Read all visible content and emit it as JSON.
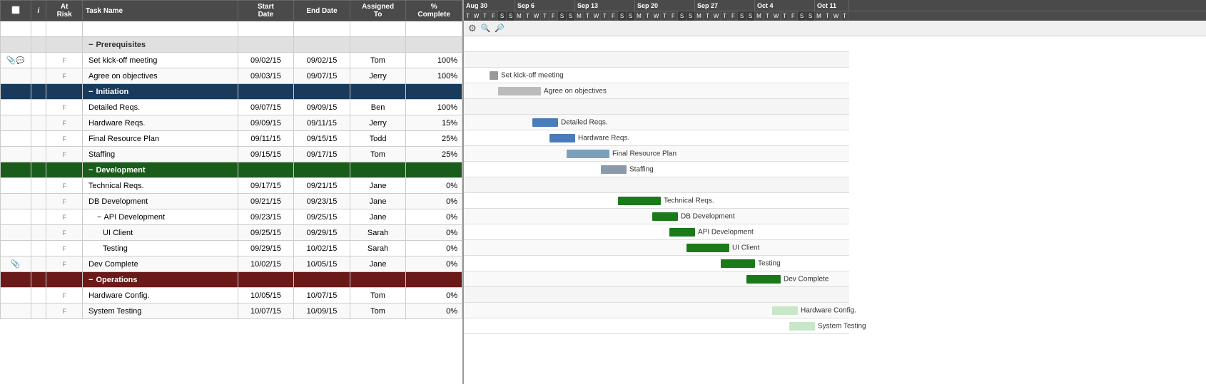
{
  "header": {
    "cols": [
      "",
      "i",
      "At Risk",
      "Task Name",
      "Start Date",
      "End Date",
      "Assigned To",
      "% Complete"
    ]
  },
  "tasks": [
    {
      "id": "blank1",
      "type": "blank",
      "flag": "",
      "alert": "",
      "name": "",
      "start": "",
      "end": "",
      "assigned": "",
      "pct": ""
    },
    {
      "id": "grp-prereq",
      "type": "group-prereq",
      "flag": "",
      "alert": "",
      "name": "Prerequisites",
      "start": "",
      "end": "",
      "assigned": "",
      "pct": "",
      "collapse": "−"
    },
    {
      "id": "task1",
      "type": "task",
      "flag": "F",
      "alert": "attach+comment",
      "name": "Set kick-off meeting",
      "start": "09/02/15",
      "end": "09/02/15",
      "assigned": "Tom",
      "pct": "100%"
    },
    {
      "id": "task2",
      "type": "task",
      "flag": "F",
      "alert": "",
      "name": "Agree on objectives",
      "start": "09/03/15",
      "end": "09/07/15",
      "assigned": "Jerry",
      "pct": "100%"
    },
    {
      "id": "grp-init",
      "type": "group-initiation",
      "flag": "",
      "alert": "",
      "name": "Initiation",
      "start": "",
      "end": "",
      "assigned": "",
      "pct": "",
      "collapse": "−"
    },
    {
      "id": "task3",
      "type": "task",
      "flag": "F",
      "alert": "",
      "name": "Detailed Reqs.",
      "start": "09/07/15",
      "end": "09/09/15",
      "assigned": "Ben",
      "pct": "100%"
    },
    {
      "id": "task4",
      "type": "task",
      "flag": "F",
      "alert": "",
      "name": "Hardware Reqs.",
      "start": "09/09/15",
      "end": "09/11/15",
      "assigned": "Jerry",
      "pct": "15%"
    },
    {
      "id": "task5",
      "type": "task",
      "flag": "F",
      "alert": "",
      "name": "Final Resource Plan",
      "start": "09/11/15",
      "end": "09/15/15",
      "assigned": "Todd",
      "pct": "25%"
    },
    {
      "id": "task6",
      "type": "task",
      "flag": "F",
      "alert": "",
      "name": "Staffing",
      "start": "09/15/15",
      "end": "09/17/15",
      "assigned": "Tom",
      "pct": "25%"
    },
    {
      "id": "grp-dev",
      "type": "group-dev",
      "flag": "",
      "alert": "alert",
      "name": "Development",
      "start": "",
      "end": "",
      "assigned": "",
      "pct": "",
      "collapse": "−"
    },
    {
      "id": "task7",
      "type": "task",
      "flag": "F",
      "alert": "",
      "name": "Technical Reqs.",
      "start": "09/17/15",
      "end": "09/21/15",
      "assigned": "Jane",
      "pct": "0%"
    },
    {
      "id": "task8",
      "type": "task",
      "flag": "F",
      "alert": "",
      "name": "DB Development",
      "start": "09/21/15",
      "end": "09/23/15",
      "assigned": "Jane",
      "pct": "0%"
    },
    {
      "id": "task9",
      "type": "task",
      "flag": "F",
      "alert": "",
      "name": "API Development",
      "start": "09/23/15",
      "end": "09/25/15",
      "assigned": "Jane",
      "pct": "0%",
      "sub": true,
      "collapse": "−"
    },
    {
      "id": "task10",
      "type": "task",
      "flag": "F",
      "alert": "",
      "name": "UI Client",
      "start": "09/25/15",
      "end": "09/29/15",
      "assigned": "Sarah",
      "pct": "0%",
      "indent": 2
    },
    {
      "id": "task11",
      "type": "task",
      "flag": "F",
      "alert": "",
      "name": "Testing",
      "start": "09/29/15",
      "end": "10/02/15",
      "assigned": "Sarah",
      "pct": "0%",
      "indent": 2
    },
    {
      "id": "task12",
      "type": "task",
      "flag": "F",
      "alert": "attach",
      "name": "Dev Complete",
      "start": "10/02/15",
      "end": "10/05/15",
      "assigned": "Jane",
      "pct": "0%"
    },
    {
      "id": "grp-ops",
      "type": "group-ops",
      "flag": "",
      "alert": "",
      "name": "Operations",
      "start": "",
      "end": "",
      "assigned": "",
      "pct": "",
      "collapse": "−"
    },
    {
      "id": "task13",
      "type": "task",
      "flag": "F",
      "alert": "",
      "name": "Hardware Config.",
      "start": "10/05/15",
      "end": "10/07/15",
      "assigned": "Tom",
      "pct": "0%"
    },
    {
      "id": "task14",
      "type": "task",
      "flag": "F",
      "alert": "",
      "name": "System Testing",
      "start": "10/07/15",
      "end": "10/09/15",
      "assigned": "Tom",
      "pct": "0%"
    }
  ],
  "gantt": {
    "toolbar": {
      "gear": "⚙",
      "search": "🔍",
      "zoom": "🔎"
    },
    "dateGroups": [
      {
        "label": "Aug 30",
        "days": [
          "T",
          "W",
          "T",
          "F",
          "S",
          "S"
        ]
      },
      {
        "label": "Sep 6",
        "days": [
          "M",
          "T",
          "W",
          "T",
          "F",
          "S",
          "S"
        ]
      },
      {
        "label": "Sep 13",
        "days": [
          "M",
          "T",
          "W",
          "T",
          "F",
          "S",
          "S"
        ]
      },
      {
        "label": "Sep 20",
        "days": [
          "M",
          "T",
          "W",
          "T",
          "F",
          "S",
          "S"
        ]
      },
      {
        "label": "Sep 27",
        "days": [
          "M",
          "T",
          "W",
          "T",
          "F",
          "S",
          "S"
        ]
      },
      {
        "label": "Oct 4",
        "days": [
          "M",
          "T",
          "W",
          "T",
          "F",
          "S",
          "S"
        ]
      },
      {
        "label": "Oct 11",
        "days": [
          "M",
          "T",
          "W",
          "T"
        ]
      }
    ],
    "bars": [
      {
        "rowId": "task1",
        "label": "Set kick-off meeting",
        "color": "#999",
        "startDay": 3,
        "spanDays": 1,
        "labelRight": true
      },
      {
        "rowId": "task2",
        "label": "Agree on objectives",
        "color": "#bbb",
        "startDay": 4,
        "spanDays": 5,
        "labelRight": true
      },
      {
        "rowId": "task3",
        "label": "Detailed Reqs.",
        "color": "#4a7cba",
        "startDay": 8,
        "spanDays": 3,
        "labelRight": true
      },
      {
        "rowId": "task4",
        "label": "Hardware Reqs.",
        "color": "#4a7cba",
        "startDay": 10,
        "spanDays": 3,
        "progress": 15,
        "labelRight": true
      },
      {
        "rowId": "task5",
        "label": "Final Resource Plan",
        "color": "#7a9fba",
        "startDay": 12,
        "spanDays": 5,
        "progress": 25,
        "labelRight": true
      },
      {
        "rowId": "task6",
        "label": "Staffing",
        "color": "#8a9aaa",
        "startDay": 16,
        "spanDays": 3,
        "progress": 25,
        "labelRight": true
      },
      {
        "rowId": "task7",
        "label": "Technical Reqs.",
        "color": "#1a7a1a",
        "startDay": 18,
        "spanDays": 5,
        "labelRight": true
      },
      {
        "rowId": "task8",
        "label": "DB Development",
        "color": "#1a7a1a",
        "startDay": 22,
        "spanDays": 3,
        "labelRight": true
      },
      {
        "rowId": "task9",
        "label": "API Development",
        "color": "#1a7a1a",
        "startDay": 24,
        "spanDays": 3,
        "labelRight": true
      },
      {
        "rowId": "task10",
        "label": "UI Client",
        "color": "#1a7a1a",
        "startDay": 26,
        "spanDays": 5,
        "labelRight": true
      },
      {
        "rowId": "task11",
        "label": "Testing",
        "color": "#1a7a1a",
        "startDay": 30,
        "spanDays": 4,
        "labelRight": true
      },
      {
        "rowId": "task12",
        "label": "Dev Complete",
        "color": "#1a7a1a",
        "startDay": 33,
        "spanDays": 4,
        "labelRight": true
      },
      {
        "rowId": "task13",
        "label": "Hardware Config.",
        "color": "#c8e6c8",
        "startDay": 36,
        "spanDays": 3,
        "labelRight": true
      },
      {
        "rowId": "task14",
        "label": "System Testing",
        "color": "#c8e6c8",
        "startDay": 38,
        "spanDays": 3,
        "labelRight": true
      }
    ]
  }
}
